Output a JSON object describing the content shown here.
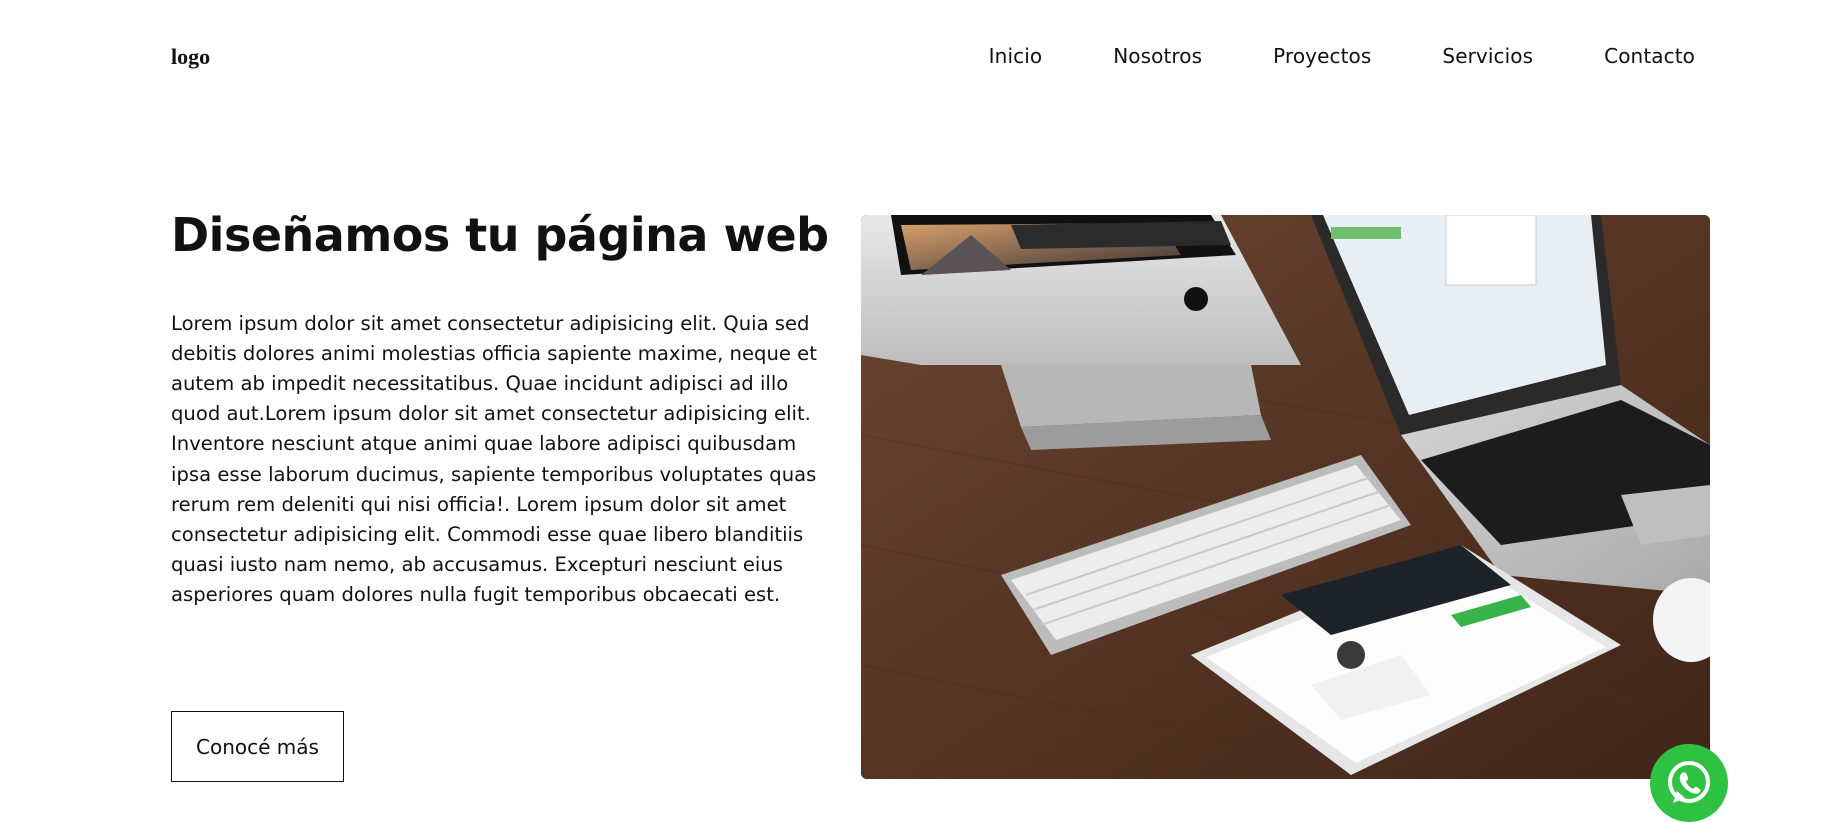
{
  "header": {
    "logo": "logo",
    "nav": [
      "Inicio",
      "Nosotros",
      "Proyectos",
      "Servicios",
      "Contacto"
    ]
  },
  "hero": {
    "title": "Diseñamos tu página web",
    "text": "Lorem ipsum dolor sit amet consectetur adipisicing elit. Quia sed debitis dolores animi molestias officia sapiente maxime, neque et autem ab impedit necessitatibus. Quae incidunt adipisci ad illo quod aut.Lorem ipsum dolor sit amet consectetur adipisicing elit. Inventore nesciunt atque animi quae labore adipisci quibusdam ipsa esse laborum ducimus, sapiente temporibus voluptates quas rerum rem deleniti qui nisi officia!. Lorem ipsum dolor sit amet consectetur adipisicing elit. Commodi esse quae libero blanditiis quasi iusto nam nemo, ab accusamus. Excepturi nesciunt eius asperiores quam dolores nulla fugit temporibus obcaecati est.",
    "cta_label": "Conocé más",
    "image_icon": "desk-with-imac-macbook-ipad-photo"
  },
  "floating": {
    "icon": "whatsapp-icon",
    "color": "#2fc142"
  }
}
